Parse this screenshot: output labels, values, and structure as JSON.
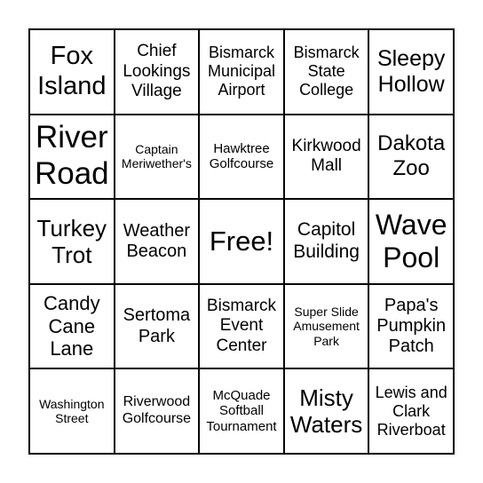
{
  "card": {
    "cells": [
      "Fox Island",
      "Chief Lookings Village",
      "Bismarck Municipal Airport",
      "Bismarck State College",
      "Sleepy Hollow",
      "River Road",
      "Captain Meriwether's",
      "Hawktree Golfcourse",
      "Kirkwood Mall",
      "Dakota Zoo",
      "Turkey Trot",
      "Weather Beacon",
      "Free!",
      "Capitol Building",
      "Wave Pool",
      "Candy Cane Lane",
      "Sertoma Park",
      "Bismarck Event Center",
      "Super Slide Amusement Park",
      "Papa's Pumpkin Patch",
      "Washington Street",
      "Riverwood Golfcourse",
      "McQuade Softball Tournament",
      "Misty Waters",
      "Lewis and Clark Riverboat"
    ]
  }
}
